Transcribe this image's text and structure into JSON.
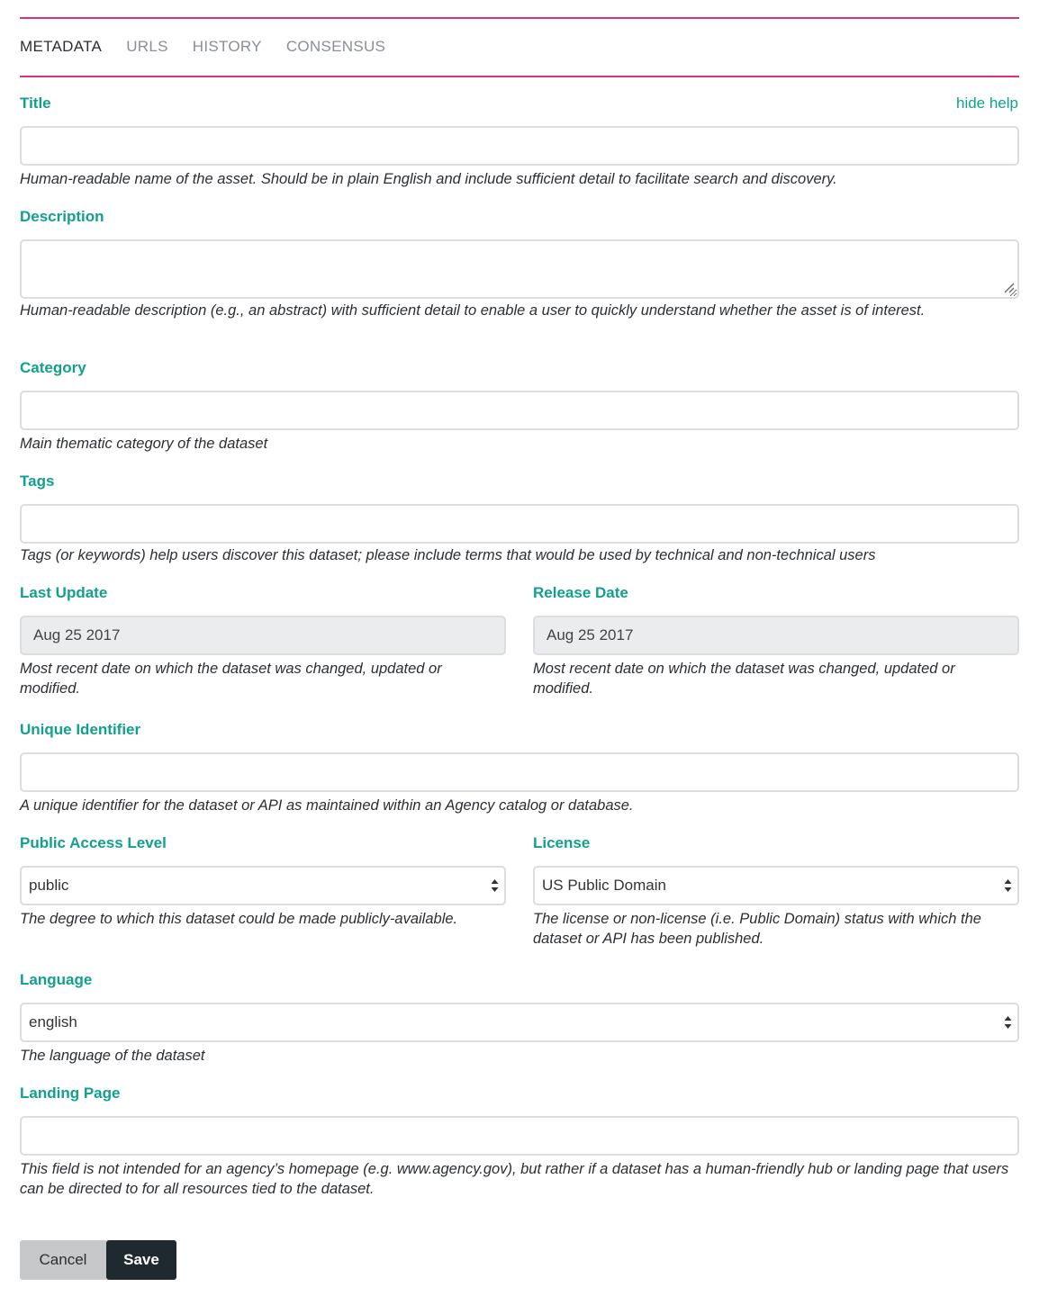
{
  "tabs": [
    "METADATA",
    "URLS",
    "HISTORY",
    "CONSENSUS"
  ],
  "hide_help": "hide help",
  "fields": {
    "title": {
      "label": "Title",
      "value": "",
      "help": "Human-readable name of the asset. Should be in plain English and include sufficient detail to facilitate search and discovery."
    },
    "description": {
      "label": "Description",
      "value": "",
      "help": "Human-readable description (e.g., an abstract) with sufficient detail to enable a user to quickly understand whether the asset is of interest."
    },
    "category": {
      "label": "Category",
      "value": "",
      "help": "Main thematic category of the dataset"
    },
    "tags": {
      "label": "Tags",
      "value": "",
      "help": "Tags (or keywords) help users discover this dataset; please include terms that would be used by technical and non-technical users"
    },
    "last_update": {
      "label": "Last Update",
      "value": "Aug 25 2017",
      "help": "Most recent date on which the dataset was changed, updated or modified."
    },
    "release_date": {
      "label": "Release Date",
      "value": "Aug 25 2017",
      "help": "Most recent date on which the dataset was changed, updated or modified."
    },
    "unique_identifier": {
      "label": "Unique Identifier",
      "value": "",
      "help": "A unique identifier for the dataset or API as maintained within an Agency catalog or database."
    },
    "public_access_level": {
      "label": "Public Access Level",
      "value": "public",
      "help": "The degree to which this dataset could be made publicly-available."
    },
    "license": {
      "label": "License",
      "value": "US Public Domain",
      "help": "The license or non-license (i.e. Public Domain) status with which the dataset or API has been published."
    },
    "language": {
      "label": "Language",
      "value": "english",
      "help": "The language of the dataset"
    },
    "landing_page": {
      "label": "Landing Page",
      "value": "",
      "help": "This field is not intended for an agency’s homepage (e.g. www.agency.gov), but rather if a dataset has a human-friendly hub or landing page that users can be directed to for all resources tied to the dataset."
    }
  },
  "buttons": {
    "cancel": "Cancel",
    "save": "Save"
  },
  "colors": {
    "accent": "#12a08e",
    "divider": "#d63384",
    "save_bg": "#1f2a30",
    "cancel_bg": "#c7c8ca"
  }
}
